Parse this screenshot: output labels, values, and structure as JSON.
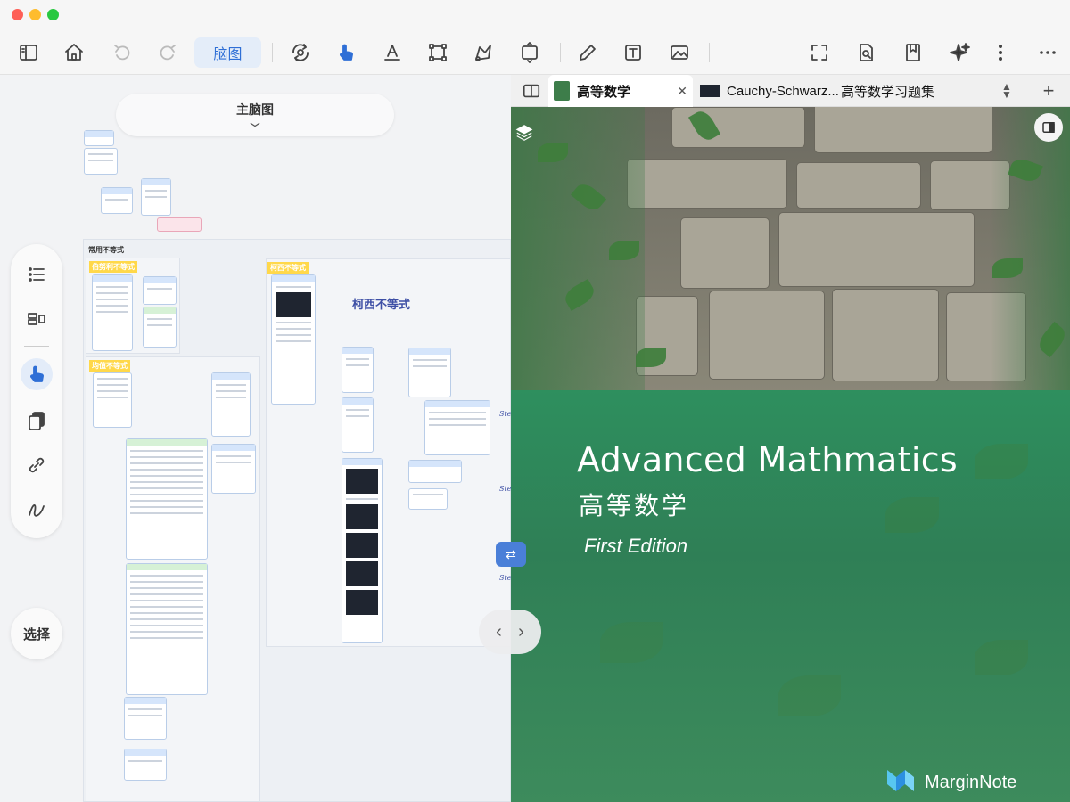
{
  "toolbar": {
    "mode_label": "脑图"
  },
  "mindmap": {
    "title": "主脑图",
    "group_main": "常用不等式",
    "group1": "伯努利不等式",
    "group2": "均值不等式",
    "group3": "柯西不等式",
    "handwriting": [
      "柯西不等式",
      "Step",
      "Step",
      "Step"
    ]
  },
  "sidebar": {
    "select_label": "选择"
  },
  "tabs": [
    {
      "label": "高等数学",
      "close": "✕"
    },
    {
      "label": "Cauchy-Schwarz..."
    },
    {
      "label": "高等数学习题集"
    }
  ],
  "document": {
    "title": "Advanced Mathmatics",
    "subtitle": "高等数学",
    "edition": "First Edition",
    "brand": "MarginNote"
  },
  "colors": {
    "accent": "#2f6fd6",
    "cover_green": "#2e8f5e",
    "tag_yellow": "#ffd84a"
  }
}
